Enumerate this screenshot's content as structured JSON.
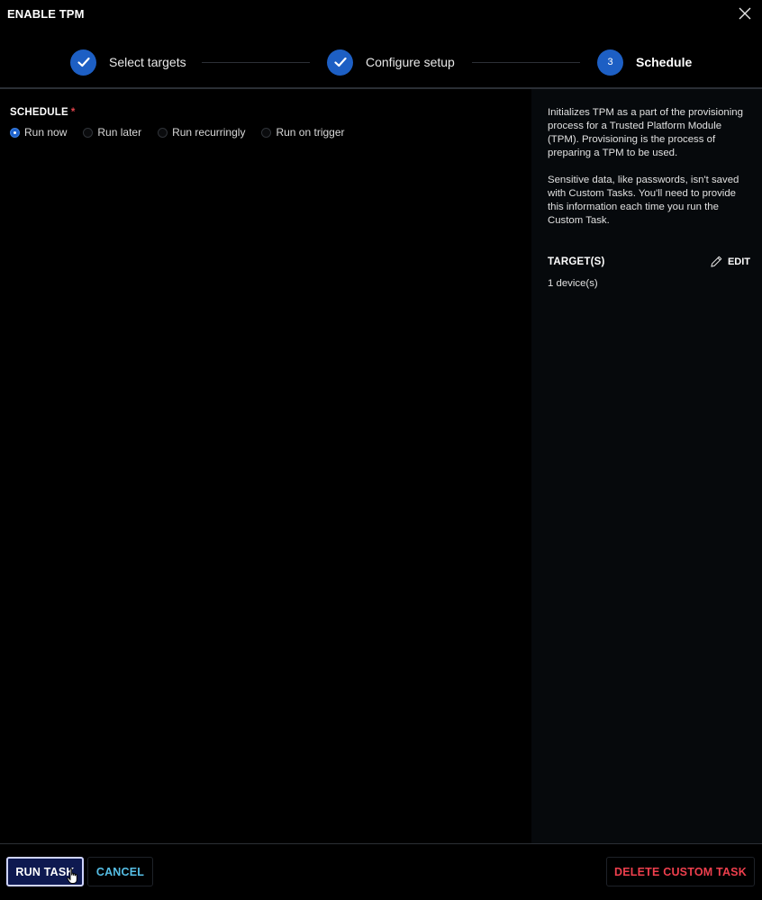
{
  "header": {
    "title": "ENABLE TPM",
    "close_icon": "close-icon"
  },
  "stepper": {
    "steps": [
      {
        "label": "Select targets",
        "status": "complete",
        "icon": "check-icon"
      },
      {
        "label": "Configure setup",
        "status": "complete",
        "icon": "check-icon"
      },
      {
        "label": "Schedule",
        "status": "active",
        "number": "3"
      }
    ]
  },
  "schedule": {
    "label": "SCHEDULE",
    "required_mark": "*",
    "options": [
      {
        "label": "Run now",
        "selected": true
      },
      {
        "label": "Run later",
        "selected": false
      },
      {
        "label": "Run recurringly",
        "selected": false
      },
      {
        "label": "Run on trigger",
        "selected": false
      }
    ]
  },
  "sidebar": {
    "description_1": "Initializes TPM as a part of the provisioning process for a Trusted Platform Module (TPM). Provisioning is the process of preparing a TPM to be used.",
    "description_2": "Sensitive data, like passwords, isn't saved with Custom Tasks. You'll need to provide this information each time you run the Custom Task.",
    "targets_title": "TARGET(S)",
    "edit_label": "EDIT",
    "edit_icon": "pencil-icon",
    "device_count": "1 device(s)"
  },
  "footer": {
    "run_label": "RUN TASK",
    "cancel_label": "CANCEL",
    "delete_label": "DELETE CUSTOM TASK"
  },
  "colors": {
    "accent_blue": "#1d5fc4",
    "cancel_text": "#56bfe6",
    "danger": "#ee3f4d",
    "required": "#e0434b"
  }
}
